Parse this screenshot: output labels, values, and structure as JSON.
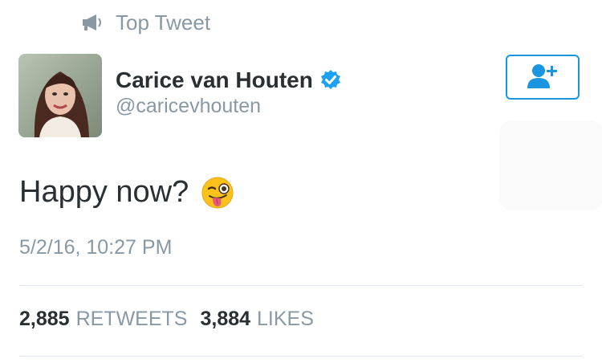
{
  "header": {
    "label": "Top Tweet",
    "icon": "megaphone-icon"
  },
  "author": {
    "display_name": "Carice van Houten",
    "handle": "@caricevhouten",
    "verified": true,
    "verified_icon": "verified-badge-icon"
  },
  "follow_button": {
    "icon": "add-user-icon",
    "color": "#1b95e0"
  },
  "tweet": {
    "text": "Happy now?",
    "emoji": "winking-face-with-tongue-icon",
    "timestamp": "5/2/16, 10:27 PM"
  },
  "stats": {
    "retweets": {
      "count": "2,885",
      "label": "RETWEETS"
    },
    "likes": {
      "count": "3,884",
      "label": "LIKES"
    }
  },
  "colors": {
    "primary_text": "#292f33",
    "secondary_text": "#8899a6",
    "accent": "#1b95e0",
    "divider": "#e1e8ed"
  }
}
